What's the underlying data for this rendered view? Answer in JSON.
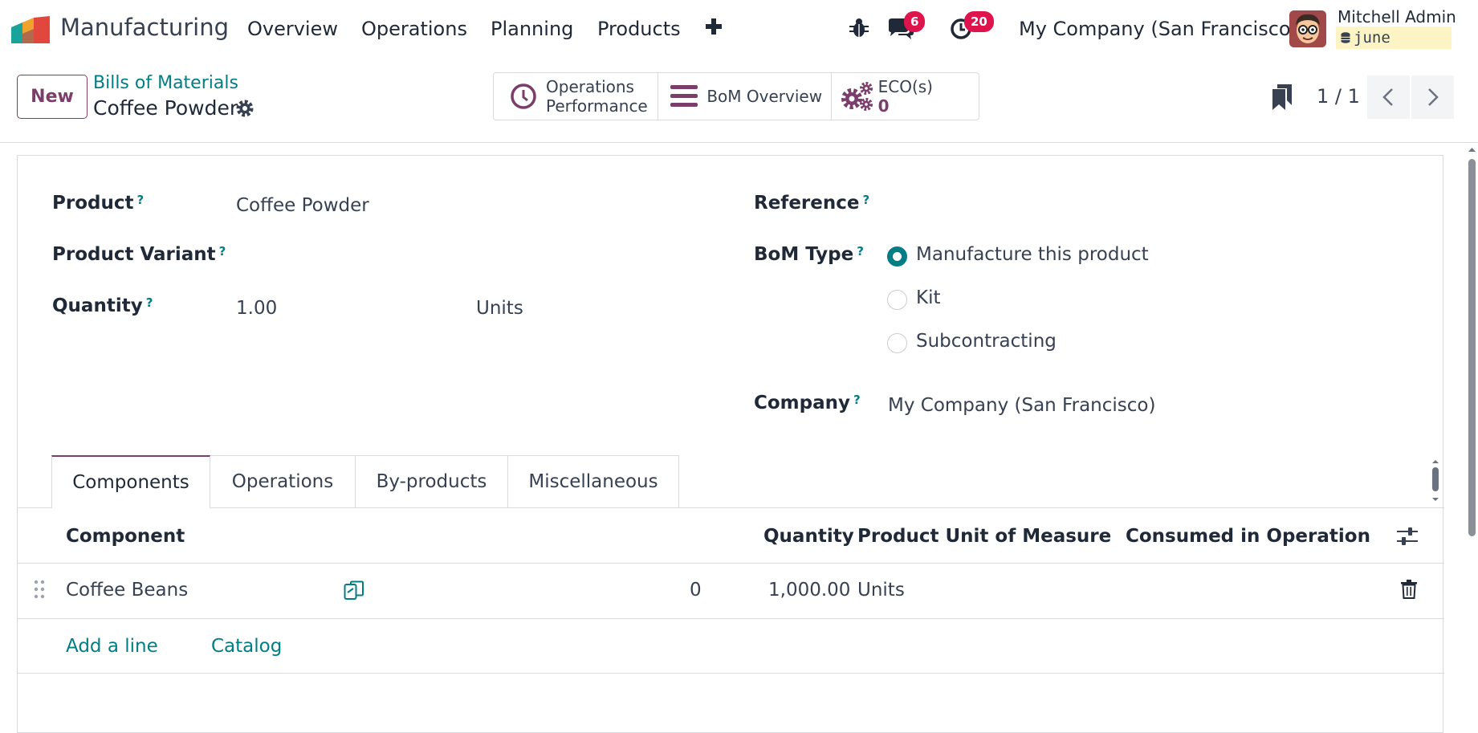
{
  "navbar": {
    "app_name": "Manufacturing",
    "menu": [
      "Overview",
      "Operations",
      "Planning",
      "Products"
    ],
    "plus_icon": "plus-icon",
    "messages_count": "6",
    "activities_count": "20",
    "company": "My Company (San Francisco)",
    "user_name": "Mitchell Admin",
    "database": "june"
  },
  "control_panel": {
    "new_label": "New",
    "breadcrumb": "Bills of Materials",
    "record_title": "Coffee Powder",
    "smart_buttons": {
      "operations_performance_line1": "Operations",
      "operations_performance_line2": "Performance",
      "bom_overview": "BoM Overview",
      "eco_label": "ECO(s)",
      "eco_count": "0"
    },
    "pager": "1 / 1"
  },
  "form": {
    "product_label": "Product",
    "product_value": "Coffee Powder",
    "variant_label": "Product Variant",
    "quantity_label": "Quantity",
    "quantity_value": "1.00",
    "quantity_uom": "Units",
    "reference_label": "Reference",
    "bom_type_label": "BoM Type",
    "bom_type_options": [
      "Manufacture this product",
      "Kit",
      "Subcontracting"
    ],
    "bom_type_selected": "Manufacture this product",
    "company_label": "Company",
    "company_value": "My Company (San Francisco)",
    "help_mark": "?"
  },
  "tabs": [
    "Components",
    "Operations",
    "By-products",
    "Miscellaneous"
  ],
  "components_table": {
    "headers": {
      "component": "Component",
      "quantity": "Quantity",
      "uom": "Product Unit of Measure",
      "operation": "Consumed in Operation"
    },
    "rows": [
      {
        "component": "Coffee Beans",
        "forecast": "0",
        "quantity": "1,000.00",
        "uom": "Units"
      }
    ],
    "add_line": "Add a line",
    "catalog": "Catalog"
  },
  "colors": {
    "brand": "#7b3e6b",
    "link": "#017e84",
    "badge": "#e0144c"
  }
}
